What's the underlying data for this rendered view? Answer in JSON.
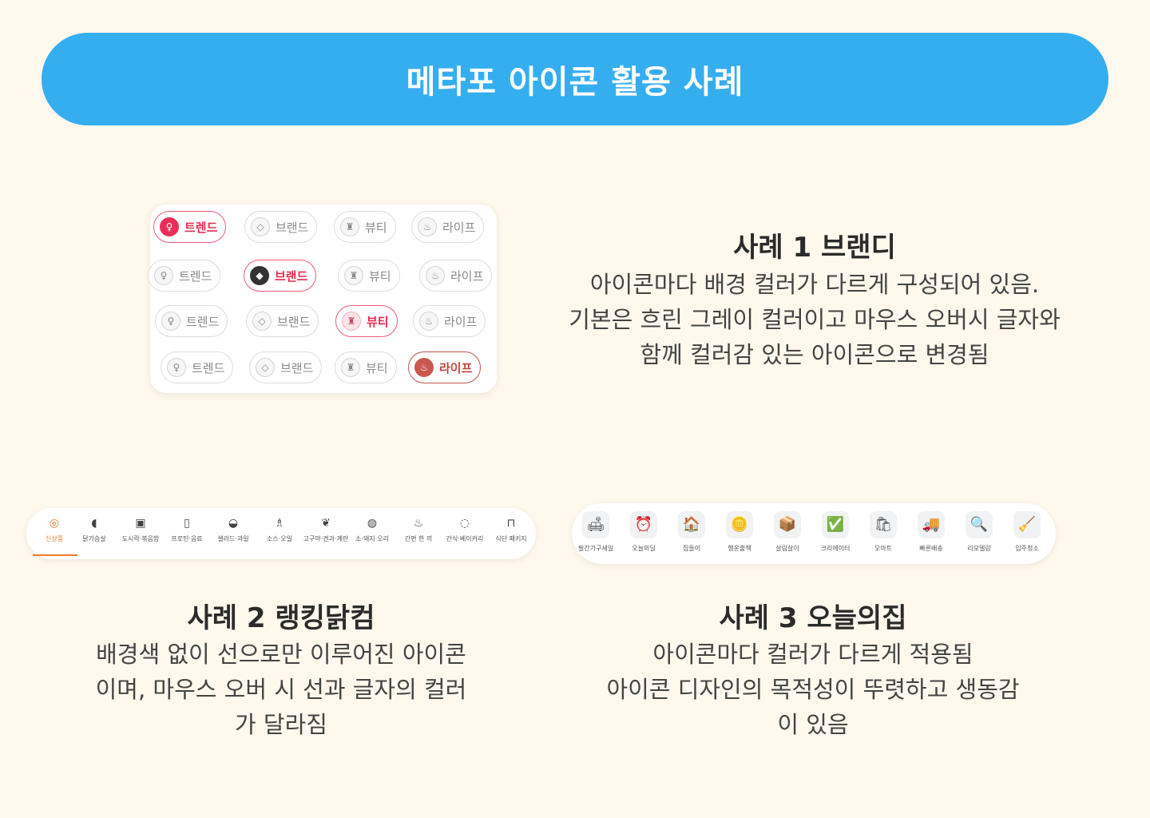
{
  "header": {
    "title": "메타포 아이콘 활용 사례"
  },
  "case1": {
    "title": "사례 1 브랜디",
    "desc": [
      "아이콘마다 배경 컬러가 다르게 구성되어 있음.",
      "기본은 흐린 그레이 컬러이고 마우스 오버시 글자와",
      "함께 컬러감 있는 아이콘으로 변경됨"
    ],
    "pills": {
      "trend": "트렌드",
      "brand": "브랜드",
      "beauty": "뷰티",
      "life": "라이프"
    }
  },
  "case2": {
    "title": "사례 2 랭킹닭컴",
    "desc": [
      "배경색 없이 선으로만 이루어진 아이콘",
      "이며, 마우스 오버 시 선과 글자의 컬러",
      "가 달라짐"
    ],
    "categories": [
      "신상품",
      "닭가슴살",
      "도시락·볶음밥",
      "프로틴·음료",
      "샐러드·과일",
      "소스·오일",
      "고구마·견과·계란",
      "소·돼지·오리",
      "간편 한 끼",
      "간식·베이커리",
      "식단 패키지"
    ],
    "active_color": "#f07c2a"
  },
  "case3": {
    "title": "사례 3 오늘의집",
    "desc": [
      "아이콘마다 컬러가 다르게 적용됨",
      "아이콘 디자인의 목적성이 뚜렷하고 생동감",
      "이 있음"
    ],
    "categories": [
      "필간가구세일",
      "오늘의딜",
      "집들이",
      "행운출첵",
      "살림살이",
      "크리에이터",
      "오마트",
      "빠른배송",
      "리모델링",
      "입주청소"
    ]
  },
  "colors": {
    "background": "#fef8ed",
    "banner": "#35aef0",
    "highlight": "#e7294f"
  }
}
